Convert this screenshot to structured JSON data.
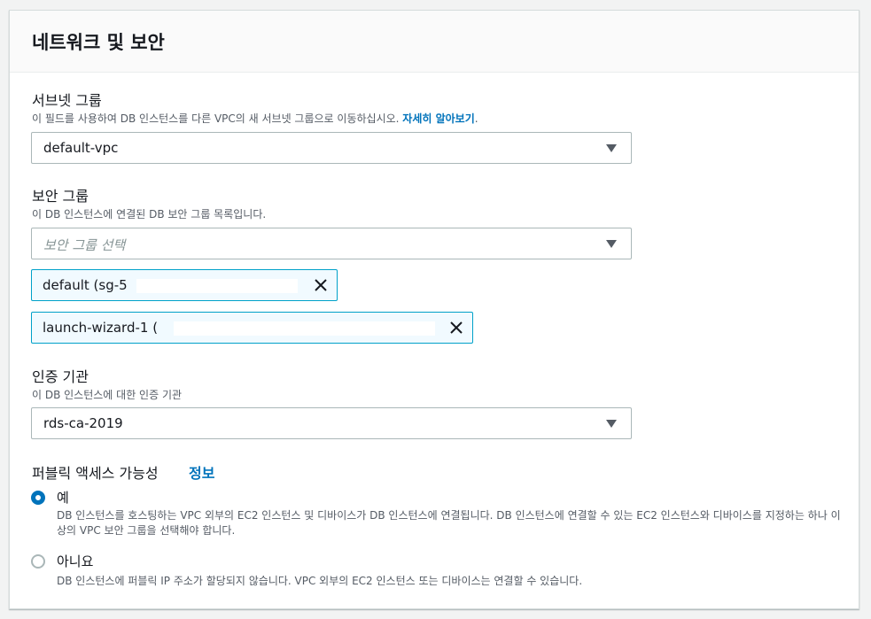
{
  "section": {
    "title": "네트워크 및 보안"
  },
  "subnet_group": {
    "label": "서브넷 그룹",
    "description": "이 필드를 사용하여 DB 인스턴스를 다른 VPC의 새 서브넷 그룹으로 이동하십시오.",
    "link": "자세히 알아보기",
    "link_suffix": ".",
    "value": "default-vpc"
  },
  "security_group": {
    "label": "보안 그룹",
    "description": "이 DB 인스턴스에 연결된 DB 보안 그룹 목록입니다.",
    "placeholder": "보안 그룹 선택",
    "tokens": [
      "default (sg-5",
      "launch-wizard-1 ("
    ]
  },
  "certificate_authority": {
    "label": "인증 기관",
    "description": "이 DB 인스턴스에 대한 인증 기관",
    "value": "rds-ca-2019"
  },
  "public_access": {
    "label": "퍼블릭 액세스 가능성",
    "info": "정보",
    "options": [
      {
        "label": "예",
        "selected": true,
        "description": "DB 인스턴스를 호스팅하는 VPC 외부의 EC2 인스턴스 및 디바이스가 DB 인스턴스에 연결됩니다. DB 인스턴스에 연결할 수 있는 EC2 인스턴스와 디바이스를 지정하는 하나 이상의 VPC 보안 그룹을 선택해야 합니다."
      },
      {
        "label": "아니요",
        "selected": false,
        "description": "DB 인스턴스에 퍼블릭 IP 주소가 할당되지 않습니다. VPC 외부의 EC2 인스턴스 또는 디바이스는 연결할 수 있습니다."
      }
    ]
  },
  "colors": {
    "accent": "#0073bb",
    "token_border": "#00a1c9"
  },
  "icons": {
    "caret": "caret-down-icon",
    "remove": "close-icon"
  }
}
